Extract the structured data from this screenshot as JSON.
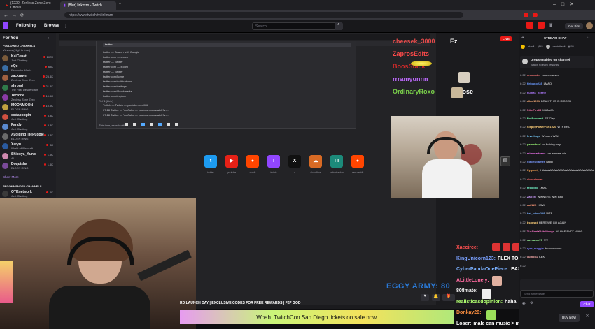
{
  "browser": {
    "tabs": [
      {
        "label": "(1220) Zenless Zone Zero Official",
        "active": false
      },
      {
        "label": "(Blur) lirikmzn - Twitch",
        "sub": "Lirik4ev",
        "active": true
      }
    ],
    "url": "https://www.twitch.tv/lirikmzn",
    "get_bits": "Get Bits"
  },
  "twitch": {
    "following": "Following",
    "browse": "Browse",
    "search_placeholder": "Search"
  },
  "sidebar": {
    "for_you": "For You",
    "followed_title": "FOLLOWED CHANNELS",
    "followed_sub": "Viewers (High to Low)",
    "followed": [
      {
        "name": "KaiCenat",
        "game": "Just Chatting",
        "viewers": "107K",
        "color": "#7a5a3a"
      },
      {
        "name": "xQc",
        "game": "Fireworks Mania",
        "viewers": "63K",
        "color": "#3a6ea5"
      },
      {
        "name": "zackrawrr",
        "game": "Zenless Zone Zero",
        "viewers": "25.4K",
        "color": "#a06040"
      },
      {
        "name": "shroud",
        "game": "The First Descendant",
        "viewers": "21.4K",
        "color": "#2f7a4a"
      },
      {
        "name": "Tectone",
        "game": "Zenless Zone Zero",
        "viewers": "10.6K",
        "color": "#8a3aa5"
      },
      {
        "name": "MOONMOON",
        "game": "ELDEN RING",
        "viewers": "10.9K",
        "color": "#c0a040"
      },
      {
        "name": "sodapoppin",
        "game": "Just Chatting",
        "viewers": "5.3K",
        "color": "#d05040"
      },
      {
        "name": "Fandy",
        "game": "Just Chatting",
        "viewers": "3.8K",
        "color": "#5a8ad0"
      },
      {
        "name": "AvoidingThePuddle",
        "game": "ELDEN RING",
        "viewers": "3.4K",
        "color": "#6a6a6a"
      },
      {
        "name": "Xaryu",
        "game": "World of Warcraft",
        "viewers": "3K",
        "color": "#2a5aa0"
      },
      {
        "name": "Shiboya_Kuno",
        "game": "AI",
        "viewers": "1.9K",
        "color": "#d08ab0"
      },
      {
        "name": "Doquisha",
        "game": "ELDEN RING",
        "viewers": "1.5K",
        "color": "#7a4a9a"
      }
    ],
    "show_more": "Show More",
    "recommended_title": "RECOMMENDED CHANNELS",
    "recommended": [
      {
        "name": "OTKnetwork",
        "game": "Just Chatting",
        "viewers": "5K",
        "color": "#3a3a3a"
      },
      {
        "name": "ironmouse",
        "game": "Fireworks Mania",
        "viewers": "6.5K",
        "color": "#c04a8a"
      },
      {
        "name": "OTCinderella",
        "game": "",
        "viewers": "4.6K",
        "color": "#8a6a4a"
      }
    ]
  },
  "inner_browser": {
    "search_text": "twitter",
    "rows": [
      "twitter — Search with Google",
      "twitter.com — x.com",
      "twitter — Twitter",
      "twitter.com — x.com",
      "twitter — Twitter",
      "twitter.com/home",
      "twitter.com/notifications",
      "twitter.com/settings",
      "twitter.com/i/bookmarks",
      "twitter.com/explore"
    ],
    "ref_label": "Ref 1 (Lirik)",
    "ref_rows": [
      "Twitch — Twitch — youtube.com/lirik",
      "07:18 Twitter — YouTube — youtube.com/watch?v=...",
      "07:18 Twitter — YouTube — youtube.com/watch?v=..."
    ],
    "footer": "This time, search with:",
    "shortcuts": [
      {
        "label": "twitter",
        "color": "#1d9bf0",
        "glyph": "t"
      },
      {
        "label": "youtube",
        "color": "#e62117",
        "glyph": "▶"
      },
      {
        "label": "reddit",
        "color": "#ff4500",
        "glyph": "●"
      },
      {
        "label": "twitch",
        "color": "#9146ff",
        "glyph": "T"
      },
      {
        "label": "x",
        "color": "#111",
        "glyph": "X"
      },
      {
        "label": "cloudflare",
        "color": "#d86a24",
        "glyph": "☁"
      },
      {
        "label": "twitchtracker",
        "color": "#1c8a7a",
        "glyph": "TT"
      },
      {
        "label": "new-reddit",
        "color": "#ff4500",
        "glyph": "●"
      }
    ]
  },
  "stream_overlay": {
    "live": "LIVE",
    "left_chat": [
      {
        "user": "cheesek_3000",
        "text": "Ez",
        "color": "#e24a4a"
      },
      {
        "user": "ZaprosEdits",
        "text": "",
        "color": "#ff4a4a"
      },
      {
        "user": "BoosStack",
        "text": "",
        "color": "#d02a2a"
      },
      {
        "user": "rrramyunnn",
        "text": "",
        "color": "#bf6aff"
      },
      {
        "user": "OrdinaryRoxo",
        "text": "Lose",
        "color": "#7ad04a"
      }
    ],
    "eggy": "EGGY ARMY: 80",
    "ticker": "RD LAUNCH DAY | EXCLUSIVE CODES FOR FREE REWARDS | F2P GOD",
    "banner": "Woah. TwitchCon San Diego tickets on sale now.",
    "bottom_chat": [
      {
        "user": "Xaecirce:",
        "text": "",
        "color": "#ff5050"
      },
      {
        "user": "KingUnicorn123:",
        "text": "FLEX TO Him",
        "color": "#7aa0ff"
      },
      {
        "user": "CyberPandaOnePiece:",
        "text": "EASIEST GAME",
        "color": "#7ab0ff"
      },
      {
        "user": "ALittleLonely:",
        "text": "",
        "color": "#ff6aa0"
      },
      {
        "user": "808mate:",
        "text": "",
        "color": "#ffffff"
      },
      {
        "user": "realisticasdopinion:",
        "text": "haha",
        "color": "#b0ff70"
      },
      {
        "user": "Donkay20:",
        "text": "",
        "color": "#ff9040"
      },
      {
        "user": "Loser:",
        "text": "male can music > male chat?",
        "color": "#ffffff"
      }
    ]
  },
  "chat": {
    "title": "STREAM CHAT",
    "drops_title": "Drops enabled on channel",
    "drops_sub": "Watch to earn rewards",
    "messages": [
      {
        "t": "6:22",
        "u": "rexmaster",
        "m": "zoomerwaved",
        "c": "#ff7a7a"
      },
      {
        "t": "6:22",
        "u": "Hrigano228",
        "m": "LMAO",
        "c": "#6a9aff"
      },
      {
        "t": "6:22",
        "u": "numas_hearty",
        "m": "",
        "c": "#b07aff"
      },
      {
        "t": "6:22",
        "u": "alkar1991",
        "m": "BRUH THIS IS RIGGED",
        "c": "#ffb07a"
      },
      {
        "t": "6:22",
        "u": "StimFire68",
        "m": "MAJAJA",
        "c": "#ff7ab0"
      },
      {
        "t": "6:22",
        "u": "NotBrowsed",
        "m": "EZ Clap",
        "c": "#7affb0"
      },
      {
        "t": "6:22",
        "u": "SleppyPowerFart1020",
        "m": "WTF BRO",
        "c": "#ffd07a"
      },
      {
        "t": "6:22",
        "u": "feverlingo",
        "m": "Winners WIN",
        "c": "#7ad0ff"
      },
      {
        "t": "6:22",
        "u": "gamerbarf",
        "m": "no fucking way",
        "c": "#a0ff7a"
      },
      {
        "t": "6:22",
        "u": "mimimadness",
        "m": "um winners win",
        "c": "#ff7aff"
      },
      {
        "t": "6:22",
        "u": "StaceDgamer",
        "m": "happi",
        "c": "#7a9aff"
      },
      {
        "t": "6:22",
        "u": "Kygarbi_",
        "m": "HAAAAAAAAAAAAAAAAAAAAAAAAAAAAAAA",
        "c": "#ffaa55"
      },
      {
        "t": "6:22",
        "u": "obnoxiemar",
        "m": "",
        "c": "#ff6a6a"
      },
      {
        "t": "6:22",
        "u": "regolino",
        "m": "1MAO",
        "c": "#7affd0"
      },
      {
        "t": "6:22",
        "u": "ZapTM",
        "m": "WINNERS WIN Icao",
        "c": "#d0a0ff"
      },
      {
        "t": "6:22",
        "u": "caZ222",
        "m": "HOW",
        "c": "#ff9a7a"
      },
      {
        "t": "6:22",
        "u": "bat_lohan228",
        "m": "WTF",
        "c": "#7ab0ff"
      },
      {
        "t": "6:22",
        "u": "bspesst",
        "m": "HERE WE GO AGAIN",
        "c": "#ffd07a"
      },
      {
        "t": "6:22",
        "u": "TheRealWhiteMango",
        "m": "WHALE BUFF LMAO",
        "c": "#ff7ad0"
      },
      {
        "t": "6:22",
        "u": "savdatox17",
        "m": "???",
        "c": "#a0ffa0"
      },
      {
        "t": "6:22",
        "u": "ryzz_meggie",
        "m": "brooooooooo",
        "c": "#7a7aff"
      },
      {
        "t": "6:22",
        "u": "vumbo1",
        "m": "KEK",
        "c": "#ffb0b0"
      },
      {
        "t": "6:22",
        "u": "",
        "m": "",
        "c": "#ffffff"
      }
    ],
    "send_placeholder": "Send a message",
    "chat_button": "Chat",
    "buy_now": "Buy Now"
  }
}
